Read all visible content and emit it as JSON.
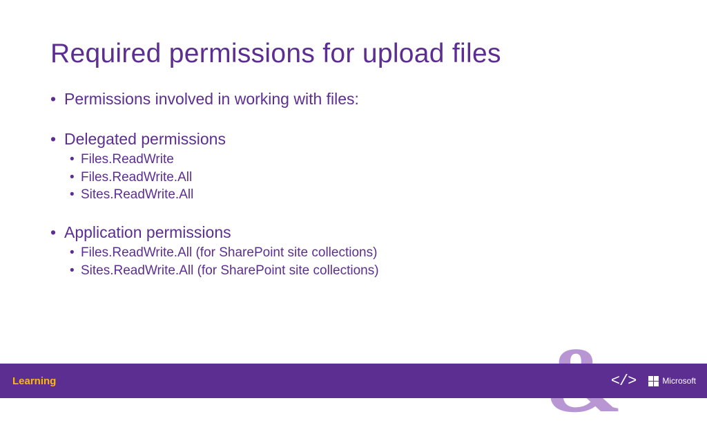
{
  "slide": {
    "title": "Required permissions for upload files",
    "intro": "Permissions involved in working with files:",
    "sections": [
      {
        "heading": "Delegated permissions",
        "items": [
          "Files.ReadWrite",
          "Files.ReadWrite.All",
          "Sites.ReadWrite.All"
        ]
      },
      {
        "heading": "Application permissions",
        "items": [
          "Files.ReadWrite.All (for SharePoint site collections)",
          "Sites.ReadWrite.All (for SharePoint site collections)"
        ]
      }
    ]
  },
  "footer": {
    "learning": "Learning",
    "code_symbol": "</>",
    "brand": "Microsoft"
  },
  "decoration": {
    "ampersand": "&"
  }
}
